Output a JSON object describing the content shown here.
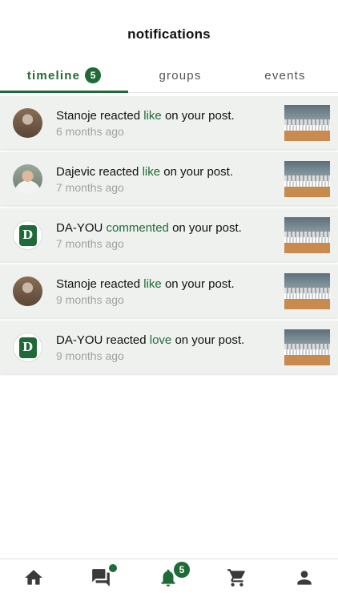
{
  "header": {
    "title": "notifications"
  },
  "tabs": [
    {
      "label": "timeline",
      "badge": "5",
      "active": true
    },
    {
      "label": "groups"
    },
    {
      "label": "events"
    }
  ],
  "colors": {
    "accent": "#1e6b37",
    "row_bg": "#eef1ee",
    "muted": "#a0a4a0"
  },
  "notifications": [
    {
      "actor": "Stanoje",
      "verb": "reacted",
      "reaction": "like",
      "suffix": "on your post.",
      "time": "6 months ago",
      "avatar": "photo"
    },
    {
      "actor": "Dajevic",
      "verb": "reacted",
      "reaction": "like",
      "suffix": "on your post.",
      "time": "7 months ago",
      "avatar": "photo"
    },
    {
      "actor": "DA-YOU",
      "verb": "",
      "reaction": "commented",
      "suffix": "on your post.",
      "time": "7 months ago",
      "avatar": "logo"
    },
    {
      "actor": "Stanoje",
      "verb": "reacted",
      "reaction": "like",
      "suffix": "on your post.",
      "time": "9 months ago",
      "avatar": "photo"
    },
    {
      "actor": "DA-YOU",
      "verb": "reacted",
      "reaction": "love",
      "suffix": "on your post.",
      "time": "9 months ago",
      "avatar": "logo"
    }
  ],
  "bottom_nav": [
    {
      "icon": "home-icon"
    },
    {
      "icon": "chat-icon",
      "dot": true
    },
    {
      "icon": "bell-icon",
      "badge": "5",
      "active": true
    },
    {
      "icon": "cart-icon"
    },
    {
      "icon": "user-icon"
    }
  ]
}
